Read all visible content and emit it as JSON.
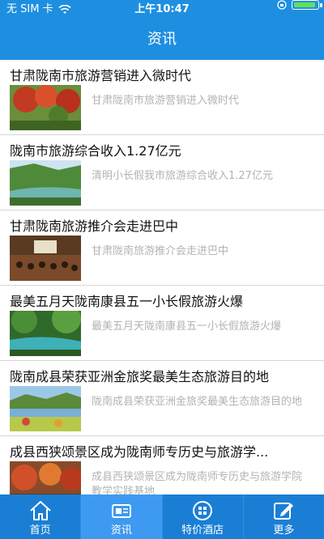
{
  "status_bar": {
    "carrier": "无 SIM 卡",
    "time": "上午10:47"
  },
  "nav": {
    "title": "资讯"
  },
  "articles": [
    {
      "title": "甘肃陇南市旅游营销进入微时代",
      "summary": "甘肃陇南市旅游营销进入微时代",
      "thumb": "red-autumn-trees"
    },
    {
      "title": "陇南市旅游综合收入1.27亿元",
      "summary": "清明小长假我市旅游综合收入1.27亿元",
      "thumb": "river-valley"
    },
    {
      "title": "甘肃陇南旅游推介会走进巴中",
      "summary": "甘肃陇南旅游推介会走进巴中",
      "thumb": "conference-hall"
    },
    {
      "title": "最美五月天陇南康县五一小长假旅游火爆",
      "summary": "最美五月天陇南康县五一小长假旅游火爆",
      "thumb": "green-forest-stream"
    },
    {
      "title": "陇南成县荣获亚洲金旅奖最美生态旅游目的地",
      "summary": "陇南成县荣获亚洲金旅奖最美生态旅游目的地",
      "thumb": "lake-landscape"
    },
    {
      "title": "成县西狭颂景区成为陇南师专历史与旅游学...",
      "summary": "成县西狭颂景区成为陇南师专历史与旅游学院教学实践基地",
      "thumb": "autumn-cliff"
    }
  ],
  "tabs": [
    {
      "label": "首页",
      "icon": "home-icon",
      "active": false
    },
    {
      "label": "资讯",
      "icon": "news-icon",
      "active": true
    },
    {
      "label": "特价酒店",
      "icon": "hotel-icon",
      "active": false
    },
    {
      "label": "更多",
      "icon": "more-icon",
      "active": false
    }
  ],
  "colors": {
    "primary": "#1e8fe0",
    "tabbar": "#1a7fd4",
    "tab_active": "#3e9af0",
    "summary_text": "#b3b3b3",
    "battery": "#5ee05e"
  }
}
